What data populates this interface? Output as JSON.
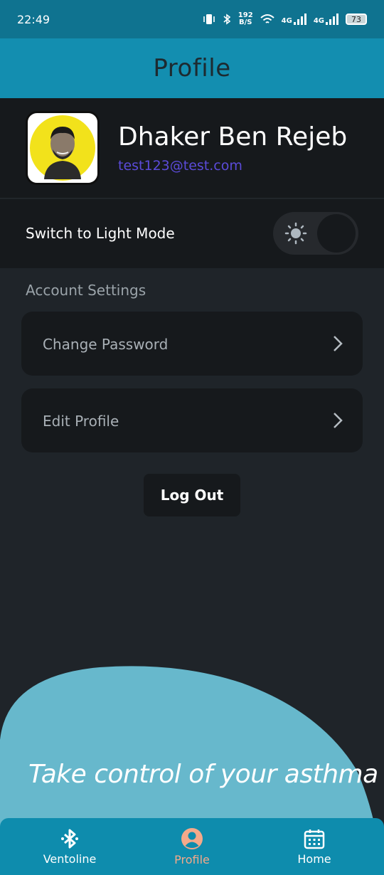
{
  "status_bar": {
    "time": "22:49",
    "net_speed": "192\nB/S",
    "net_speed_top": "192",
    "net_speed_bottom": "B/S",
    "network_1": "4G",
    "network_2": "4G",
    "battery": "73"
  },
  "app_bar": {
    "title": "Profile"
  },
  "profile": {
    "name": "Dhaker Ben Rejeb",
    "email": "test123@test.com"
  },
  "theme_toggle": {
    "label": "Switch to Light Mode",
    "icon": "sun-icon",
    "state": "off"
  },
  "account_settings": {
    "section_label": "Account Settings",
    "items": [
      {
        "label": "Change Password",
        "icon": "chevron-right-icon"
      },
      {
        "label": "Edit Profile",
        "icon": "chevron-right-icon"
      }
    ]
  },
  "logout": {
    "label": "Log Out"
  },
  "tagline": "Take control of your asthma",
  "bottom_nav": {
    "items": [
      {
        "label": "Ventoline",
        "icon": "bluetooth-icon"
      },
      {
        "label": "Profile",
        "icon": "user-icon",
        "active": true
      },
      {
        "label": "Home",
        "icon": "calendar-icon"
      }
    ]
  },
  "colors": {
    "status_bar": "#0f7390",
    "app_bar": "#138eb0",
    "background": "#1f2429",
    "card": "#16191c",
    "email": "#5b4bd9",
    "blob": "#67b8cc",
    "nav": "#0e8cad",
    "nav_active": "#f4a98a"
  }
}
